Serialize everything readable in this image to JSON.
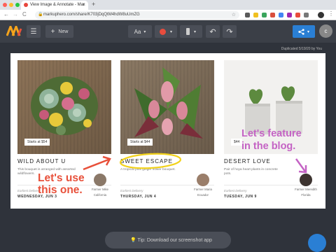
{
  "browser": {
    "tab_title": "View Image & Annotate - Mar",
    "tab_close": "×",
    "new_tab": "+",
    "url": "markuphero.com/share/K703jDqQtM4hdW8uUmZG",
    "back": "←",
    "forward": "→",
    "reload": "C",
    "lock": "🔒",
    "star": "☆",
    "kebab": "⋮",
    "traffic_colors": [
      "#ff5f57",
      "#febc2e",
      "#28c840"
    ]
  },
  "toolbar": {
    "menu_icon": "☰",
    "new_label": "New",
    "new_plus": "+",
    "font_label": "Aa",
    "caret": "▾",
    "undo": "↶",
    "redo": "↷",
    "share_icon": "⋖",
    "share_caret": "▾",
    "avatar_letter": "c",
    "color_swatch": "#e84c3d"
  },
  "duplicated_text": "Duplicated 5/19/20 by You",
  "cards": [
    {
      "price": "Starts at $54",
      "title": "WILD ABOUT U",
      "desc": "This bouquet is arranged with assorted wildflowers.",
      "delivery_label": "Earliest Delivery",
      "delivery_date": "WEDNESDAY, JUN 3",
      "farmer_name": "Farmer Mike",
      "farmer_place": "California"
    },
    {
      "price": "Starts at $44",
      "title": "SWEET ESCAPE",
      "desc": "A tropical pink ginger flower bouquet.",
      "delivery_label": "Earliest Delivery",
      "delivery_date": "THURSDAY, JUN 4",
      "farmer_name": "Farmer Maria",
      "farmer_place": "Ecuador"
    },
    {
      "price": "$44",
      "title": "DESERT LOVE",
      "desc": "Pair of hoya heart plants in concrete pots.",
      "delivery_label": "Earliest Delivery",
      "delivery_date": "TUESDAY, JUN 9",
      "farmer_name": "Farmer Meredith",
      "farmer_place": "Florida"
    }
  ],
  "annotations": {
    "left_line1": "Let's use",
    "left_line2": "this one.",
    "right_line1": "Let's feature",
    "right_line2": "in the blog.",
    "red": "#e8503a",
    "purple": "#c463c4",
    "yellow": "#f2d21a"
  },
  "tip": {
    "icon": "💡",
    "text": "Tip: Download our screenshot app"
  }
}
